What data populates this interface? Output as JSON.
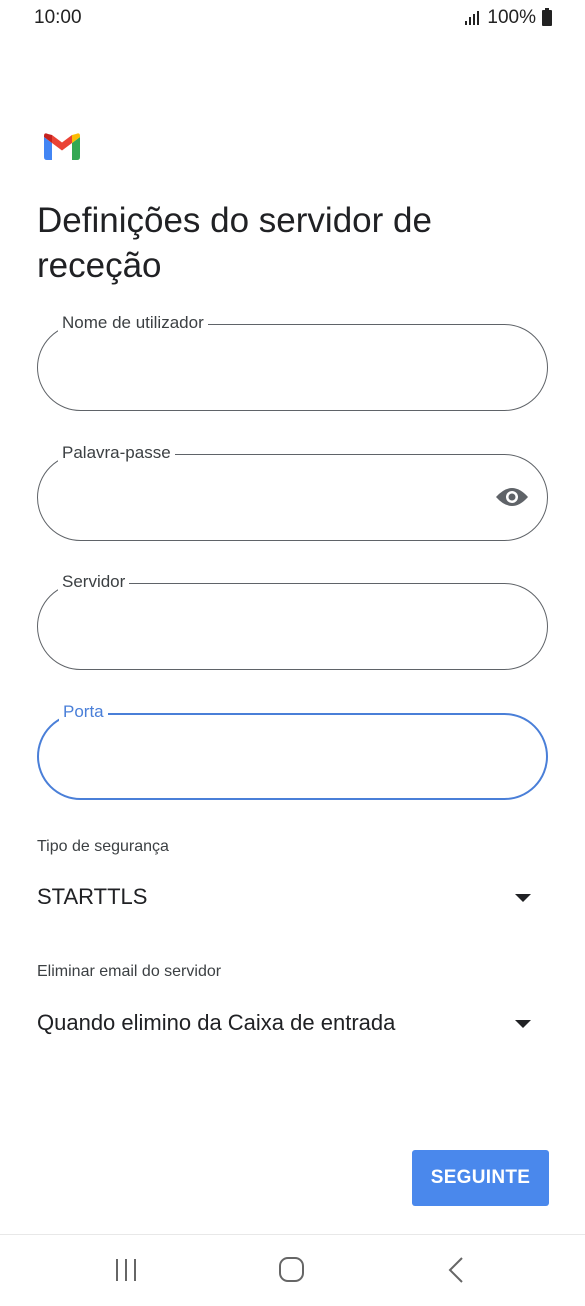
{
  "status_bar": {
    "time": "10:00",
    "battery_text": "100%"
  },
  "app": {
    "logo_icon": "gmail-logo-icon"
  },
  "title": "Definições do servidor de receção",
  "fields": {
    "username": {
      "label": "Nome de utilizador",
      "value": ""
    },
    "password": {
      "label": "Palavra-passe",
      "value": "",
      "toggle_icon": "eye-icon"
    },
    "server": {
      "label": "Servidor",
      "value": ""
    },
    "port": {
      "label": "Porta",
      "value": "",
      "focused": true
    }
  },
  "security": {
    "label": "Tipo de segurança",
    "value": "STARTTLS"
  },
  "delete_email": {
    "label": "Eliminar email do servidor",
    "value": "Quando elimino da Caixa de entrada"
  },
  "next_button": "SEGUINTE",
  "colors": {
    "accent": "#4a7fd8",
    "button": "#4a88ec"
  },
  "nav_icons": [
    "recents-icon",
    "home-icon",
    "back-icon"
  ]
}
